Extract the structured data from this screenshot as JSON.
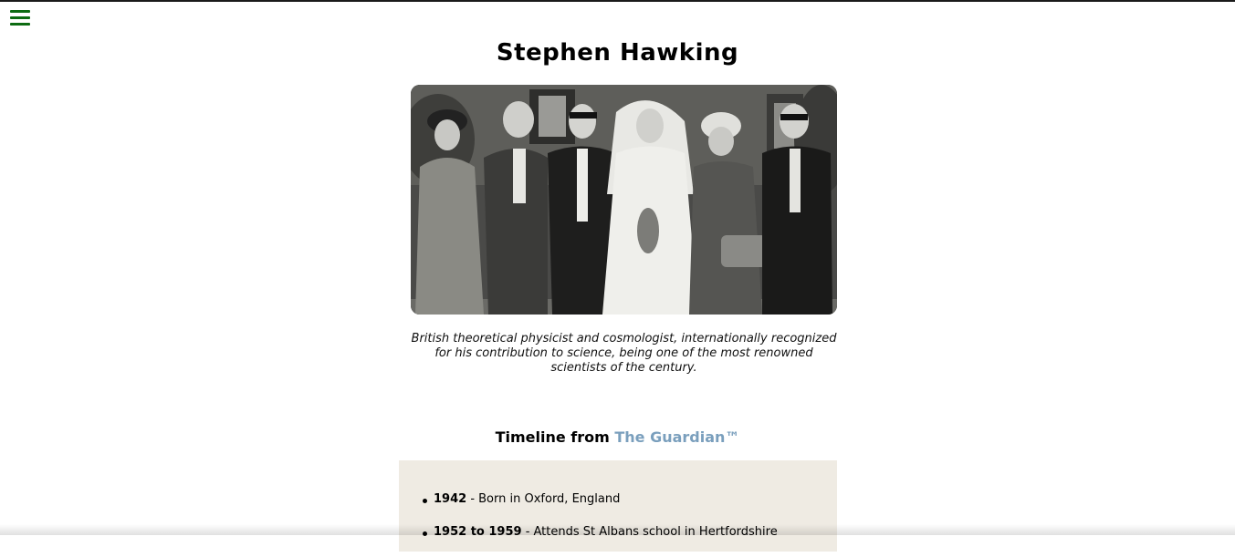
{
  "menu": {
    "icon": "hamburger-menu-icon",
    "color": "#0d6b12"
  },
  "page": {
    "title": "Stephen Hawking",
    "photo_alt": "Wedding photograph of Stephen Hawking with family",
    "caption": "British theoretical physicist and cosmologist, internationally recognized for his contribution to science, being one of the most renowned scientists of the century."
  },
  "timeline": {
    "heading_prefix": "Timeline from",
    "source_name": "The Guardian™",
    "link_color": "#7a9fbd",
    "background": "#efebe3",
    "items": [
      {
        "year": "1942",
        "text": " - Born in Oxford, England"
      },
      {
        "year": "1952 to 1959",
        "text": " - Attends St Albans school in Hertfordshire"
      }
    ]
  }
}
